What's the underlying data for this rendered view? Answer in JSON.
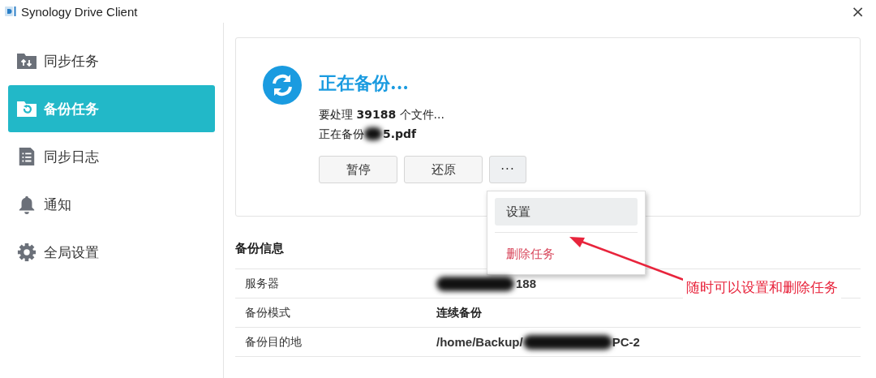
{
  "window": {
    "title": "Synology Drive Client",
    "close": "×"
  },
  "sidebar": {
    "items": [
      {
        "label": "同步任务",
        "selected": false
      },
      {
        "label": "备份任务",
        "selected": true
      },
      {
        "label": "同步日志",
        "selected": false
      },
      {
        "label": "通知",
        "selected": false
      },
      {
        "label": "全局设置",
        "selected": false
      }
    ]
  },
  "status": {
    "title": "正在备份...",
    "files_line": {
      "before": "要处理 ",
      "count": "39188",
      "after": " 个文件..."
    },
    "current_label": "正在备份 ",
    "current_file": {
      "redacted": true,
      "visible": "5.pdf"
    }
  },
  "buttons": [
    {
      "label": "暂停",
      "kind": "text"
    },
    {
      "label": "还原",
      "kind": "text"
    },
    {
      "label": "···",
      "kind": "more"
    }
  ],
  "menu": {
    "items": [
      {
        "label": "设置",
        "selected": true,
        "danger": false
      },
      {
        "label": "删除任务",
        "selected": false,
        "danger": true
      }
    ]
  },
  "info": {
    "title": "备份信息",
    "rows": [
      {
        "label": "服务器",
        "before": "",
        "redacted": true,
        "after": "188"
      },
      {
        "label": "备份模式",
        "before": "连续备份",
        "redacted": false,
        "after": ""
      },
      {
        "label": "备份目的地",
        "before": "/home/Backup/",
        "redacted": true,
        "after": "PC-2"
      }
    ]
  },
  "annotation": {
    "text": "随时可以设置和删除任务"
  }
}
